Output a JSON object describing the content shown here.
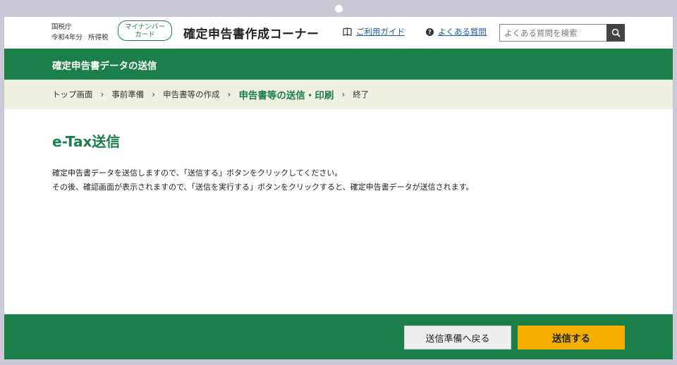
{
  "header": {
    "agency": "国税庁",
    "year": "令和4年分",
    "tax_type": "所得税",
    "mynumber_line1": "マイナンバー",
    "mynumber_line2": "カード",
    "corner_title": "確定申告書作成コーナー",
    "guide_label": "ご利用ガイド",
    "faq_label": "よくある質問",
    "search_placeholder": "よくある質問を検索"
  },
  "section_title": "確定申告書データの送信",
  "breadcrumb": [
    "トップ画面",
    "事前準備",
    "申告書等の作成",
    "申告書等の送信・印刷",
    "終了"
  ],
  "main": {
    "title": "e-Tax送信",
    "line1": "確定申告書データを送信しますので、「送信する」ボタンをクリックしてください。",
    "line2": "その後、確認画面が表示されますので、「送信を実行する」ボタンをクリックすると、確定申告書データが送信されます。"
  },
  "footer": {
    "back_label": "送信準備へ戻る",
    "send_label": "送信する"
  },
  "colors": {
    "brand_green": "#1a7f49",
    "send_button": "#f3ae00",
    "breadcrumb_bg": "#f0efe4"
  },
  "icons": {
    "guide": "book-icon",
    "faq": "question-icon",
    "search": "search-icon"
  }
}
